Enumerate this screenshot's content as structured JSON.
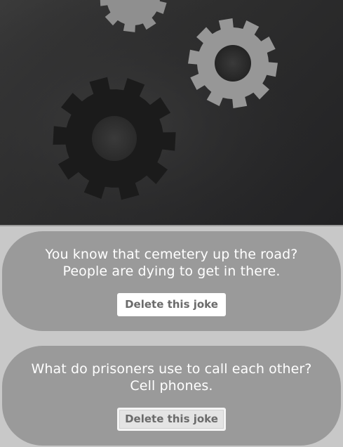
{
  "hero": {
    "icons": [
      "gear-icon",
      "gear-icon",
      "gear-icon"
    ],
    "colors": {
      "background": "#2e2e2e",
      "gear_light": "#969696",
      "gear_dark": "#1a1a1a"
    }
  },
  "jokes": [
    {
      "line1": "You know that cemetery up the road?",
      "line2": "People are dying to get in there.",
      "delete_label": "Delete this joke"
    },
    {
      "line1": "What do prisoners use to call each other?",
      "line2": "Cell phones.",
      "delete_label": "Delete this joke"
    }
  ],
  "colors": {
    "page_bg": "#c8c8c8",
    "card_bg": "#9a9a9a",
    "text": "#ffffff",
    "button_text": "#6b6b6b"
  }
}
